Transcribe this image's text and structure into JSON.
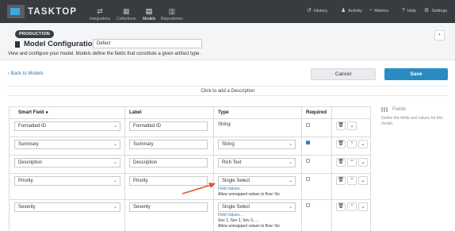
{
  "nav": {
    "logo_text": "TASKTOP",
    "items": [
      {
        "label": "Integrations",
        "icon": "integrations-icon"
      },
      {
        "label": "Collections",
        "icon": "collections-icon"
      },
      {
        "label": "Models",
        "icon": "models-icon",
        "active": true
      },
      {
        "label": "Repositories",
        "icon": "repositories-icon"
      }
    ],
    "right": [
      {
        "label": "History",
        "icon": "history-icon"
      },
      {
        "label": "Activity",
        "icon": "activity-icon"
      },
      {
        "label": "Metrics",
        "icon": "metrics-icon"
      },
      {
        "label": "Help",
        "icon": "help-icon"
      },
      {
        "label": "Settings",
        "icon": "settings-icon"
      }
    ]
  },
  "header": {
    "badge": "PRODUCTION",
    "title": "Model Configuration",
    "model_name": "Defect",
    "subtitle": "View and configure your model. Models define the fields that constitute a given artifact type."
  },
  "actions": {
    "back": "Back to Models",
    "cancel": "Cancel",
    "save": "Save",
    "description_prompt": "Click to add a Description"
  },
  "table": {
    "headers": {
      "smart_field": "Smart Field",
      "label": "Label",
      "type": "Type",
      "required": "Required"
    },
    "rows": [
      {
        "smart_field": "Formatted ID",
        "label": "Formatted ID",
        "type": "String",
        "type_editable": false,
        "required": false,
        "can_up": false,
        "can_down": true
      },
      {
        "smart_field": "Summary",
        "label": "Summary",
        "type": "String",
        "type_editable": true,
        "required": true,
        "can_up": true,
        "can_down": true
      },
      {
        "smart_field": "Description",
        "label": "Description",
        "type": "Rich Text",
        "type_editable": true,
        "required": false,
        "can_up": true,
        "can_down": true
      },
      {
        "smart_field": "Priority",
        "label": "Priority",
        "type": "Single Select",
        "type_editable": true,
        "required": false,
        "can_up": true,
        "can_down": true,
        "field_values_link": "Field Values...",
        "notes": [
          "Allow unmapped values to flow: No"
        ]
      },
      {
        "smart_field": "Severity",
        "label": "Severity",
        "type": "Single Select",
        "type_editable": true,
        "required": false,
        "can_up": true,
        "can_down": true,
        "field_values_link": "Field Values...",
        "notes": [
          "Sev 1, Sev 2, Sev 3, ...",
          "Allow unmapped values to flow: No"
        ]
      }
    ]
  },
  "panel": {
    "title": "Fields",
    "description": "Define the fields and values for this model."
  },
  "colors": {
    "nav_bg": "#383b40",
    "accent": "#2a8bc4",
    "link": "#2a7ab0",
    "arrow": "#e0552b"
  }
}
